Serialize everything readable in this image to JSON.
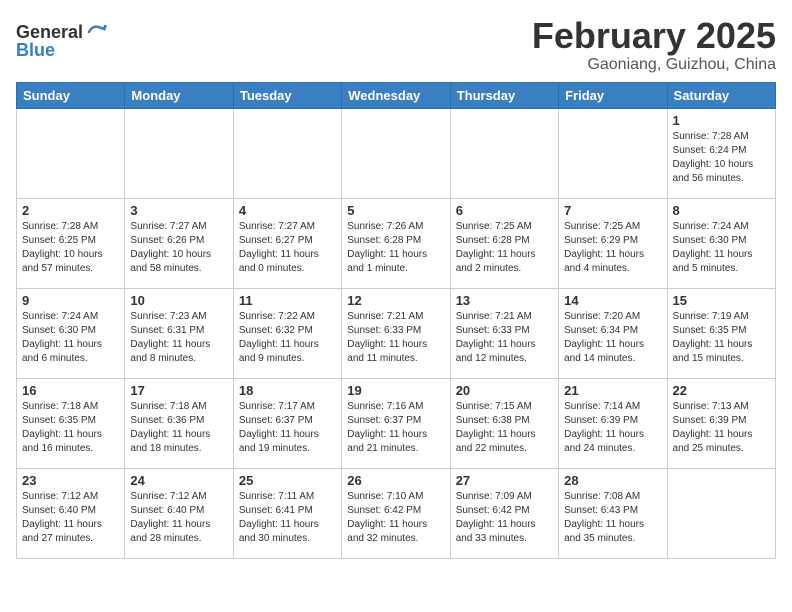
{
  "header": {
    "logo_general": "General",
    "logo_blue": "Blue",
    "month_title": "February 2025",
    "location": "Gaoniang, Guizhou, China"
  },
  "weekdays": [
    "Sunday",
    "Monday",
    "Tuesday",
    "Wednesday",
    "Thursday",
    "Friday",
    "Saturday"
  ],
  "weeks": [
    [
      {
        "day": "",
        "info": ""
      },
      {
        "day": "",
        "info": ""
      },
      {
        "day": "",
        "info": ""
      },
      {
        "day": "",
        "info": ""
      },
      {
        "day": "",
        "info": ""
      },
      {
        "day": "",
        "info": ""
      },
      {
        "day": "1",
        "info": "Sunrise: 7:28 AM\nSunset: 6:24 PM\nDaylight: 10 hours and 56 minutes."
      }
    ],
    [
      {
        "day": "2",
        "info": "Sunrise: 7:28 AM\nSunset: 6:25 PM\nDaylight: 10 hours and 57 minutes."
      },
      {
        "day": "3",
        "info": "Sunrise: 7:27 AM\nSunset: 6:26 PM\nDaylight: 10 hours and 58 minutes."
      },
      {
        "day": "4",
        "info": "Sunrise: 7:27 AM\nSunset: 6:27 PM\nDaylight: 11 hours and 0 minutes."
      },
      {
        "day": "5",
        "info": "Sunrise: 7:26 AM\nSunset: 6:28 PM\nDaylight: 11 hours and 1 minute."
      },
      {
        "day": "6",
        "info": "Sunrise: 7:25 AM\nSunset: 6:28 PM\nDaylight: 11 hours and 2 minutes."
      },
      {
        "day": "7",
        "info": "Sunrise: 7:25 AM\nSunset: 6:29 PM\nDaylight: 11 hours and 4 minutes."
      },
      {
        "day": "8",
        "info": "Sunrise: 7:24 AM\nSunset: 6:30 PM\nDaylight: 11 hours and 5 minutes."
      }
    ],
    [
      {
        "day": "9",
        "info": "Sunrise: 7:24 AM\nSunset: 6:30 PM\nDaylight: 11 hours and 6 minutes."
      },
      {
        "day": "10",
        "info": "Sunrise: 7:23 AM\nSunset: 6:31 PM\nDaylight: 11 hours and 8 minutes."
      },
      {
        "day": "11",
        "info": "Sunrise: 7:22 AM\nSunset: 6:32 PM\nDaylight: 11 hours and 9 minutes."
      },
      {
        "day": "12",
        "info": "Sunrise: 7:21 AM\nSunset: 6:33 PM\nDaylight: 11 hours and 11 minutes."
      },
      {
        "day": "13",
        "info": "Sunrise: 7:21 AM\nSunset: 6:33 PM\nDaylight: 11 hours and 12 minutes."
      },
      {
        "day": "14",
        "info": "Sunrise: 7:20 AM\nSunset: 6:34 PM\nDaylight: 11 hours and 14 minutes."
      },
      {
        "day": "15",
        "info": "Sunrise: 7:19 AM\nSunset: 6:35 PM\nDaylight: 11 hours and 15 minutes."
      }
    ],
    [
      {
        "day": "16",
        "info": "Sunrise: 7:18 AM\nSunset: 6:35 PM\nDaylight: 11 hours and 16 minutes."
      },
      {
        "day": "17",
        "info": "Sunrise: 7:18 AM\nSunset: 6:36 PM\nDaylight: 11 hours and 18 minutes."
      },
      {
        "day": "18",
        "info": "Sunrise: 7:17 AM\nSunset: 6:37 PM\nDaylight: 11 hours and 19 minutes."
      },
      {
        "day": "19",
        "info": "Sunrise: 7:16 AM\nSunset: 6:37 PM\nDaylight: 11 hours and 21 minutes."
      },
      {
        "day": "20",
        "info": "Sunrise: 7:15 AM\nSunset: 6:38 PM\nDaylight: 11 hours and 22 minutes."
      },
      {
        "day": "21",
        "info": "Sunrise: 7:14 AM\nSunset: 6:39 PM\nDaylight: 11 hours and 24 minutes."
      },
      {
        "day": "22",
        "info": "Sunrise: 7:13 AM\nSunset: 6:39 PM\nDaylight: 11 hours and 25 minutes."
      }
    ],
    [
      {
        "day": "23",
        "info": "Sunrise: 7:12 AM\nSunset: 6:40 PM\nDaylight: 11 hours and 27 minutes."
      },
      {
        "day": "24",
        "info": "Sunrise: 7:12 AM\nSunset: 6:40 PM\nDaylight: 11 hours and 28 minutes."
      },
      {
        "day": "25",
        "info": "Sunrise: 7:11 AM\nSunset: 6:41 PM\nDaylight: 11 hours and 30 minutes."
      },
      {
        "day": "26",
        "info": "Sunrise: 7:10 AM\nSunset: 6:42 PM\nDaylight: 11 hours and 32 minutes."
      },
      {
        "day": "27",
        "info": "Sunrise: 7:09 AM\nSunset: 6:42 PM\nDaylight: 11 hours and 33 minutes."
      },
      {
        "day": "28",
        "info": "Sunrise: 7:08 AM\nSunset: 6:43 PM\nDaylight: 11 hours and 35 minutes."
      },
      {
        "day": "",
        "info": ""
      }
    ]
  ]
}
